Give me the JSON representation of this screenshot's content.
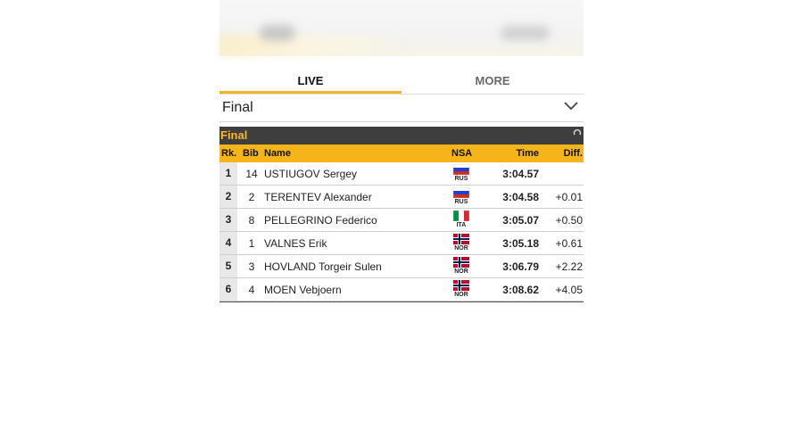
{
  "tabs": [
    {
      "label": "LIVE",
      "active": true
    },
    {
      "label": "MORE",
      "active": false
    }
  ],
  "dropdown": {
    "value": "Final",
    "icon": "chevron-down-icon"
  },
  "results": {
    "title": "Final",
    "refresh_icon": "refresh-icon",
    "columns": {
      "rank": "Rk.",
      "bib": "Bib",
      "name": "Name",
      "nsa": "NSA",
      "time": "Time",
      "diff": "Diff."
    },
    "rows": [
      {
        "rank": "1",
        "bib": "14",
        "name": "USTIUGOV Sergey",
        "nsa": "RUS",
        "time": "3:04.57",
        "diff": ""
      },
      {
        "rank": "2",
        "bib": "2",
        "name": "TERENTEV Alexander",
        "nsa": "RUS",
        "time": "3:04.58",
        "diff": "+0.01"
      },
      {
        "rank": "3",
        "bib": "8",
        "name": "PELLEGRINO Federico",
        "nsa": "ITA",
        "time": "3:05.07",
        "diff": "+0.50"
      },
      {
        "rank": "4",
        "bib": "1",
        "name": "VALNES Erik",
        "nsa": "NOR",
        "time": "3:05.18",
        "diff": "+0.61"
      },
      {
        "rank": "5",
        "bib": "3",
        "name": "HOVLAND Torgeir Sulen",
        "nsa": "NOR",
        "time": "3:06.79",
        "diff": "+2.22"
      },
      {
        "rank": "6",
        "bib": "4",
        "name": "MOEN Vebjoern",
        "nsa": "NOR",
        "time": "3:08.62",
        "diff": "+4.05"
      }
    ]
  },
  "colors": {
    "accent": "#f2b51c",
    "header_dark": "#3e3e3e",
    "title_text": "#f5b92a"
  }
}
